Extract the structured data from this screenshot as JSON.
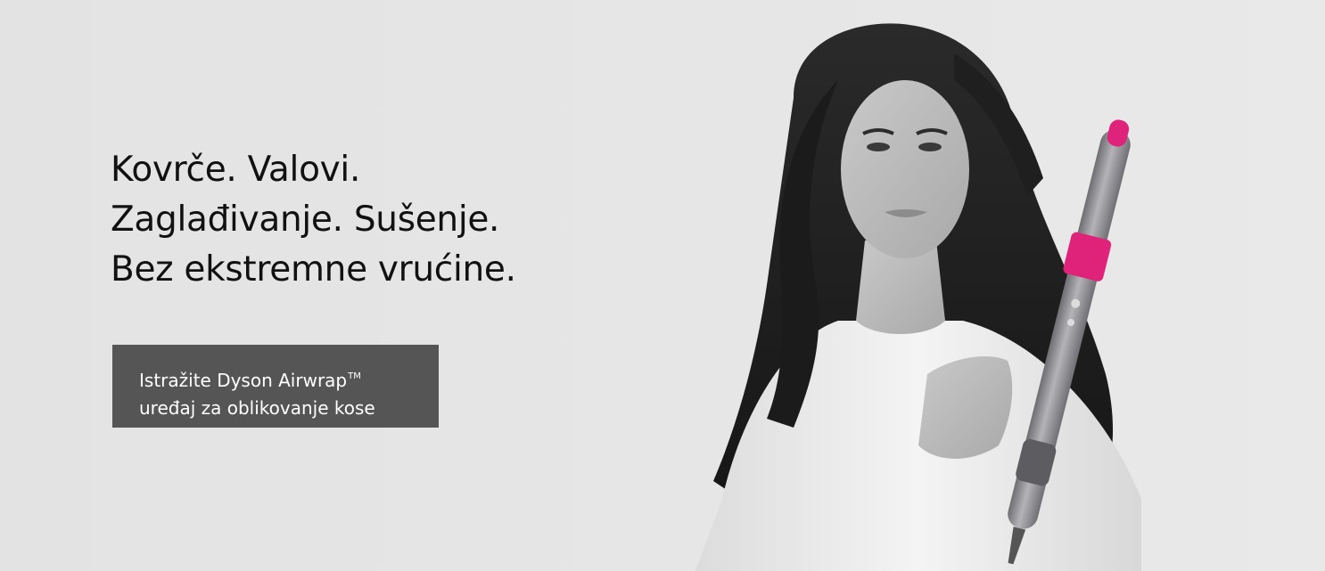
{
  "hero": {
    "headline": {
      "line1": "Kovrče. Valovi.",
      "line2": "Zaglađivanje. Sušenje.",
      "line3": "Bez ekstremne vrućine."
    },
    "cta": {
      "line1": "Istražite Dyson Airwrap",
      "trademark": "TM",
      "line2": "uređaj za oblikovanje kose"
    },
    "photo_icon": "woman-with-airwrap-styler-illustration"
  },
  "colors": {
    "background": "#e4e4e4",
    "headline_text": "#111111",
    "cta_background": "#555555",
    "cta_text": "#ffffff",
    "accent_fuchsia": "#e0237a",
    "product_nickel": "#8a8a8e"
  }
}
